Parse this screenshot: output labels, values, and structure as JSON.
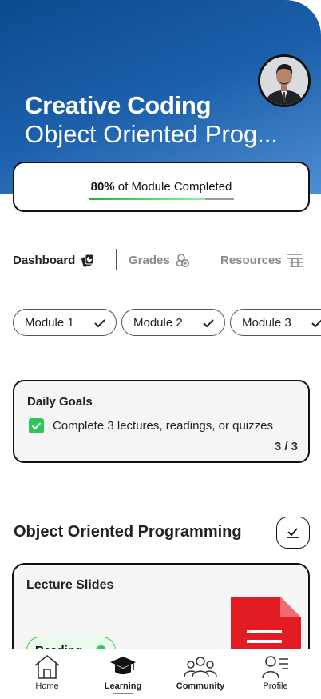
{
  "course": {
    "title": "Creative Coding",
    "subtitle": "Object Oriented Prog..."
  },
  "progress": {
    "percent_label": "80%",
    "suffix_label": " of Module Completed",
    "fraction": 0.8
  },
  "tabs": [
    {
      "label": "Dashboard",
      "icon": "dashboard-icon",
      "active": true
    },
    {
      "label": "Grades",
      "icon": "grades-icon",
      "active": false
    },
    {
      "label": "Resources",
      "icon": "resources-icon",
      "active": false
    }
  ],
  "modules": [
    {
      "label": "Module 1",
      "icon": "check-icon"
    },
    {
      "label": "Module 2",
      "icon": "check-icon"
    },
    {
      "label": "Module 3",
      "icon": "check-icon"
    }
  ],
  "daily_goals": {
    "title": "Daily Goals",
    "item": "Complete 3 lectures, readings, or quizzes",
    "count": "3 / 3"
  },
  "section": {
    "title": "Object Oriented Programming"
  },
  "lecture_card": {
    "title": "Lecture Slides",
    "badge": "Reading",
    "icon": "document-icon"
  },
  "nav": [
    {
      "label": "Home",
      "icon": "home-icon"
    },
    {
      "label": "Learning",
      "icon": "graduation-cap-icon",
      "active": true
    },
    {
      "label": "Community",
      "icon": "community-icon"
    },
    {
      "label": "Profile",
      "icon": "profile-icon"
    }
  ],
  "colors": {
    "hero_dark": "#0b4a8f",
    "hero_light": "#4d8fd3",
    "success_green": "#2fc55a",
    "document_red": "#e31b23"
  }
}
